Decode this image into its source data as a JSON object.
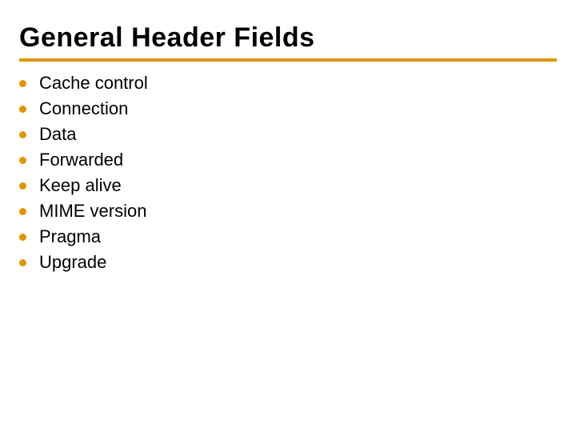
{
  "title": "General Header Fields",
  "items": [
    "Cache control",
    "Connection",
    "Data",
    "Forwarded",
    "Keep alive",
    "MIME version",
    "Pragma",
    "Upgrade"
  ]
}
